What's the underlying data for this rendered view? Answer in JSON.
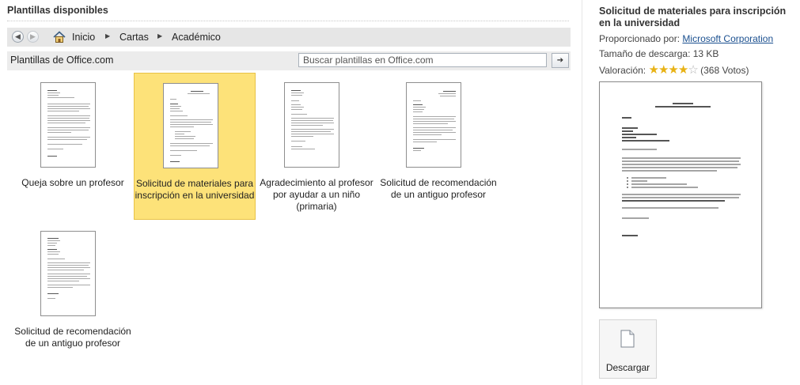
{
  "header": {
    "title": "Plantillas disponibles"
  },
  "nav": {
    "back_icon": "arrow-left-icon",
    "forward_icon": "arrow-right-icon",
    "home_icon": "home-icon",
    "breadcrumbs": [
      "Inicio",
      "Cartas",
      "Académico"
    ]
  },
  "office": {
    "label": "Plantillas de Office.com",
    "search_placeholder": "Buscar plantillas en Office.com",
    "go_icon": "arrow-right-icon"
  },
  "templates": [
    {
      "caption": "Queja sobre un profesor",
      "selected": false
    },
    {
      "caption": "Solicitud de materiales para inscripción en la universidad",
      "selected": true
    },
    {
      "caption": "Agradecimiento al profesor por ayudar a un niño (primaria)",
      "selected": false
    },
    {
      "caption": "Solicitud de recomendación de un antiguo profesor",
      "selected": false
    },
    {
      "caption": "Solicitud de recomendación de un antiguo profesor",
      "selected": false
    }
  ],
  "details": {
    "title": "Solicitud de materiales para inscripción en la universidad",
    "provided_by_label": "Proporcionado por:",
    "provider": "Microsoft Corporation",
    "download_size": "Tamaño de descarga: 13 KB",
    "rating_label": "Valoración:",
    "rating_value": 4,
    "rating_max": 5,
    "votes": "(368 Votos)",
    "download_label": "Descargar"
  },
  "colors": {
    "selected_bg": "#fde279",
    "link": "#1a4f8f",
    "star": "#e8b215"
  }
}
